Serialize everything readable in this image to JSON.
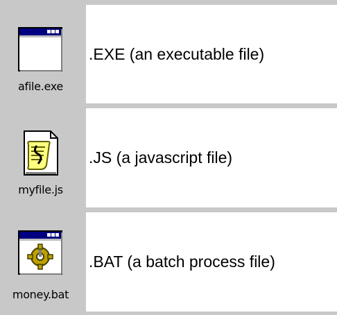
{
  "files": [
    {
      "icon": "executable-window-icon",
      "filename": "afile.exe",
      "description": ".EXE (an executable file)"
    },
    {
      "icon": "script-scroll-icon",
      "filename": "myfile.js",
      "description": ".JS (a javascript file)"
    },
    {
      "icon": "batch-gear-icon",
      "filename": "money.bat",
      "description": ".BAT (a batch process file)"
    }
  ],
  "colors": {
    "table_background": "#c8c8c8",
    "cell_background": "#ffffff",
    "titlebar_blue": "#000080",
    "scroll_yellow": "#ffff80",
    "gear_gold": "#c0a000"
  }
}
